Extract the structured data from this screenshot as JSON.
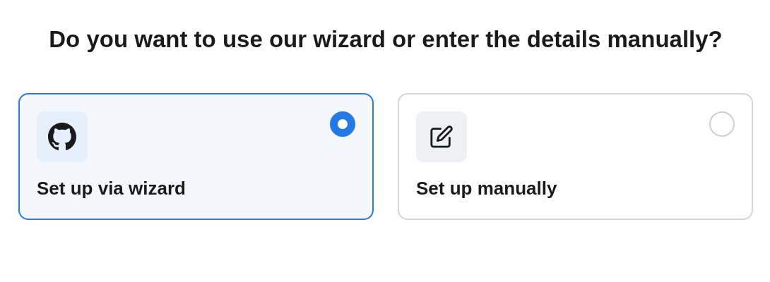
{
  "heading": "Do you want to use our wizard or enter the details manually?",
  "options": [
    {
      "kind": "wizard",
      "label": "Set up via wizard",
      "selected": true
    },
    {
      "kind": "manual",
      "label": "Set up manually",
      "selected": false
    }
  ]
}
